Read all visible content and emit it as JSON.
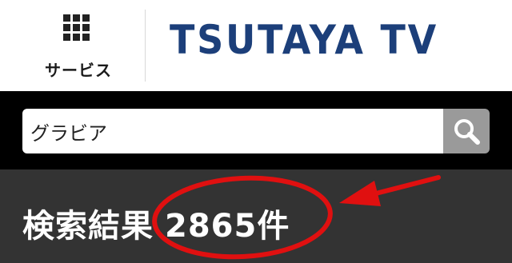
{
  "header": {
    "services_label": "サービス",
    "logo_text": "TSUTAYA TV"
  },
  "search": {
    "query": "グラビア"
  },
  "results": {
    "label": "検索結果",
    "count": "2865件"
  },
  "colors": {
    "logo": "#1c3f7a",
    "search_band": "#000000",
    "results_band": "#333333",
    "search_button": "#9a9a9a",
    "annotation": "#e01010"
  },
  "icons": {
    "services": "grid-icon",
    "search": "magnifier-icon",
    "annotation_arrow": "arrow-icon"
  }
}
